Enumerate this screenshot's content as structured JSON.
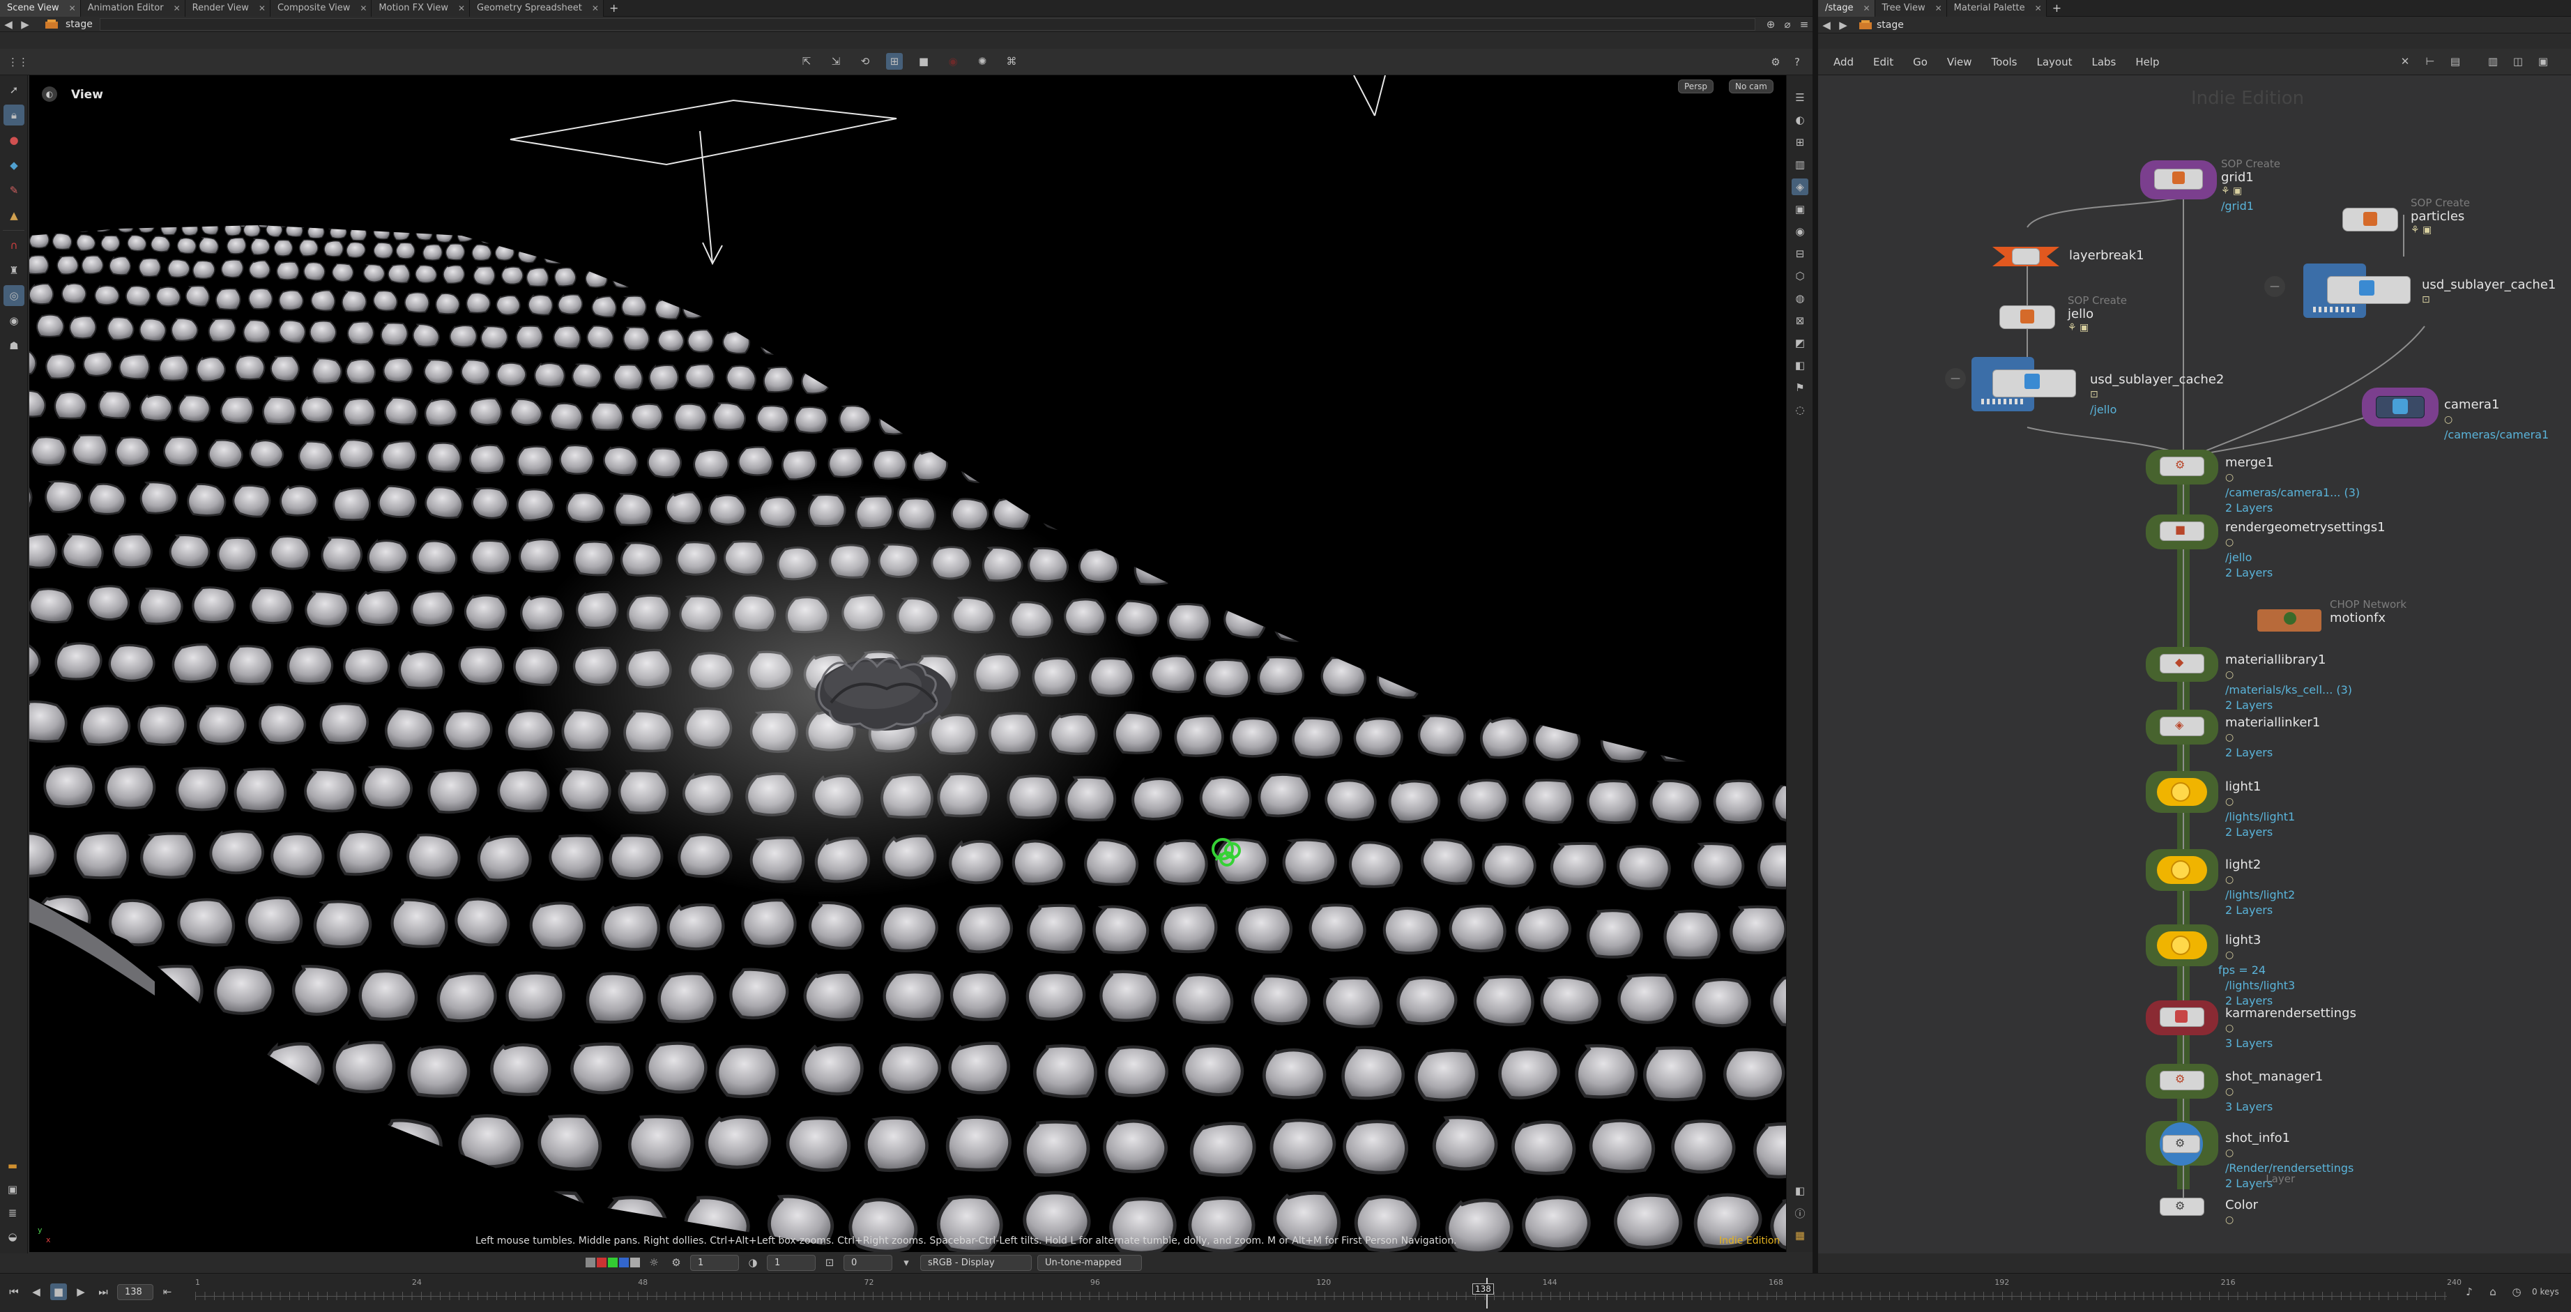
{
  "left_pane": {
    "tabs": [
      {
        "label": "Scene View",
        "active": true
      },
      {
        "label": "Animation Editor",
        "active": false
      },
      {
        "label": "Render View",
        "active": false
      },
      {
        "label": "Composite View",
        "active": false
      },
      {
        "label": "Motion FX View",
        "active": false
      },
      {
        "label": "Geometry Spreadsheet",
        "active": false
      }
    ],
    "path": "stage",
    "viewport": {
      "title": "View",
      "persp_button": "Persp",
      "camera_button": "No cam",
      "status_hint": "Left mouse tumbles. Middle pans. Right dollies. Ctrl+Alt+Left box-zooms. Ctrl+Right zooms. Spacebar-Ctrl-Left tilts. Hold L for alternate tumble, dolly, and zoom. M or Alt+M for First Person Navigation.",
      "edition_label": "Indie Edition",
      "axis_labels": {
        "y": "y",
        "x": "x"
      }
    },
    "bottom_bar": {
      "field_a": "1",
      "field_b": "1",
      "field_c": "0",
      "color_space": "sRGB - Display",
      "tone_map": "Un-tone-mapped"
    }
  },
  "right_pane": {
    "tabs": [
      {
        "label": "/stage",
        "active": true
      },
      {
        "label": "Tree View",
        "active": false
      },
      {
        "label": "Material Palette",
        "active": false
      }
    ],
    "path": "stage",
    "menu": [
      "Add",
      "Edit",
      "Go",
      "View",
      "Tools",
      "Layout",
      "Labs",
      "Help"
    ],
    "watermark": "Indie Edition",
    "nodes": {
      "grid1": {
        "category": "SOP Create",
        "name": "grid1",
        "sub": "/grid1"
      },
      "layerbreak1": {
        "name": "layerbreak1"
      },
      "jello": {
        "category": "SOP Create",
        "name": "jello"
      },
      "usd_sublayer_cache2": {
        "name": "usd_sublayer_cache2",
        "sub": "/jello"
      },
      "particles": {
        "category": "SOP Create",
        "name": "particles"
      },
      "usd_sublayer_cache1": {
        "name": "usd_sublayer_cache1"
      },
      "camera1": {
        "name": "camera1",
        "sub": "/cameras/camera1"
      },
      "merge1": {
        "name": "merge1",
        "sub": "/cameras/camera1... (3)",
        "layers": "2 Layers"
      },
      "rendergeometrysettings1": {
        "name": "rendergeometrysettings1",
        "sub": "/jello",
        "layers": "2 Layers"
      },
      "motionfx": {
        "category": "CHOP Network",
        "name": "motionfx"
      },
      "materiallibrary1": {
        "name": "materiallibrary1",
        "sub": "/materials/ks_cell... (3)",
        "layers": "2 Layers"
      },
      "materiallinker1": {
        "name": "materiallinker1",
        "layers": "2 Layers"
      },
      "light1": {
        "name": "light1",
        "sub": "/lights/light1",
        "layers": "2 Layers"
      },
      "light2": {
        "name": "light2",
        "sub": "/lights/light2",
        "layers": "2 Layers"
      },
      "light3": {
        "name": "light3",
        "extra": "fps = 24",
        "sub": "/lights/light3",
        "layers": "2 Layers"
      },
      "karmarendersettings": {
        "name": "karmarendersettings",
        "layers": "3 Layers"
      },
      "shot_manager1": {
        "name": "shot_manager1",
        "layers": "3 Layers"
      },
      "shot_info1": {
        "name": "shot_info1",
        "sub": "/Render/rendersettings",
        "layers": "2 Layers",
        "ghost": "...Layer"
      },
      "color": {
        "name": "Color"
      }
    }
  },
  "timeline": {
    "current_frame": "138",
    "ticks": [
      "1",
      "24",
      "48",
      "72",
      "96",
      "120",
      "138",
      "144",
      "168",
      "192",
      "216",
      "240"
    ],
    "marker_frame": "138",
    "keys_label": "0 keys"
  },
  "colors": {
    "accent": "#46607a",
    "node_link": "#5ab4da",
    "sop_purple": "#7b3f8e",
    "light_yellow": "#f0b400",
    "render_red": "#8a2a33",
    "break_orange": "#e2581f",
    "chop_brown": "#b86a3a",
    "selected_green": "#47632e"
  }
}
